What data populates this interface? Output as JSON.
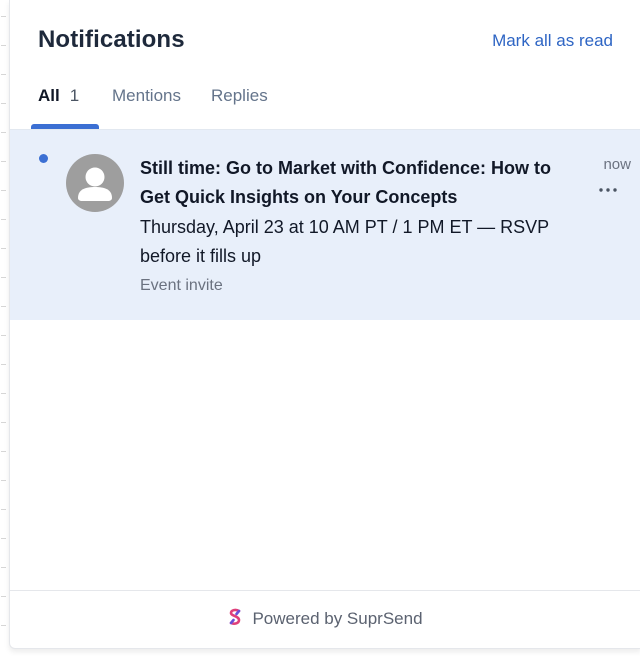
{
  "header": {
    "title": "Notifications",
    "mark_all_label": "Mark all as read"
  },
  "tabs": [
    {
      "label": "All",
      "count": "1",
      "active": true
    },
    {
      "label": "Mentions",
      "active": false
    },
    {
      "label": "Replies",
      "active": false
    }
  ],
  "notifications": [
    {
      "unread": true,
      "avatar_icon": "user-avatar-icon",
      "title": "Still time: Go to Market with Confidence: How to Get Quick Insights on Your Concepts",
      "body": "Thursday, April 23 at 10 AM PT / 1 PM ET — RSVP before it fills up",
      "subtext": "Event invite",
      "time": "now",
      "more_icon": "ellipsis-icon"
    }
  ],
  "footer": {
    "text": "Powered by SuprSend",
    "logo_icon": "suprsend-logo-icon"
  },
  "colors": {
    "accent": "#3b6fd3",
    "link": "#2e65c4",
    "unread_background": "#e8effa",
    "logo_primary": "#e0407a",
    "logo_secondary": "#6a4fd8"
  }
}
